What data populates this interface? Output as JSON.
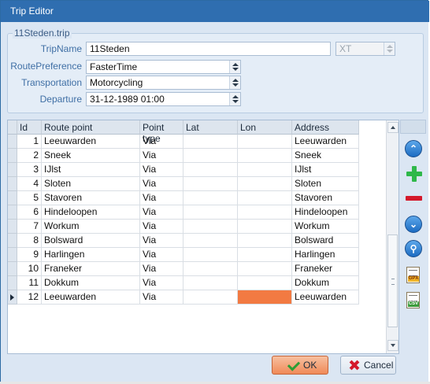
{
  "window": {
    "title": "Trip Editor"
  },
  "trip_group": {
    "legend": "11Steden.trip",
    "fields": [
      {
        "label": "TripName",
        "value": "11Steden"
      },
      {
        "label": "RoutePreference",
        "value": "FasterTime"
      },
      {
        "label": "Transportation",
        "value": "Motorcycling"
      },
      {
        "label": "Departure",
        "value": "31-12-1989 01:00"
      }
    ],
    "model_value": "XT"
  },
  "grid": {
    "columns": [
      "Id",
      "Route point",
      "Point type",
      "Lat",
      "Lon",
      "Address"
    ],
    "rows": [
      {
        "id": "1",
        "route_point": "Leeuwarden",
        "point_type": "Via",
        "lat": "",
        "lon": "",
        "address": "Leeuwarden"
      },
      {
        "id": "2",
        "route_point": "Sneek",
        "point_type": "Via",
        "lat": "",
        "lon": "",
        "address": "Sneek"
      },
      {
        "id": "3",
        "route_point": "IJlst",
        "point_type": "Via",
        "lat": "",
        "lon": "",
        "address": "IJlst"
      },
      {
        "id": "4",
        "route_point": "Sloten",
        "point_type": "Via",
        "lat": "",
        "lon": "",
        "address": "Sloten"
      },
      {
        "id": "5",
        "route_point": "Stavoren",
        "point_type": "Via",
        "lat": "",
        "lon": "",
        "address": "Stavoren"
      },
      {
        "id": "6",
        "route_point": "Hindeloopen",
        "point_type": "Via",
        "lat": "",
        "lon": "",
        "address": "Hindeloopen"
      },
      {
        "id": "7",
        "route_point": "Workum",
        "point_type": "Via",
        "lat": "",
        "lon": "",
        "address": "Workum"
      },
      {
        "id": "8",
        "route_point": "Bolsward",
        "point_type": "Via",
        "lat": "",
        "lon": "",
        "address": "Bolsward"
      },
      {
        "id": "9",
        "route_point": "Harlingen",
        "point_type": "Via",
        "lat": "",
        "lon": "",
        "address": "Harlingen"
      },
      {
        "id": "10",
        "route_point": "Franeker",
        "point_type": "Via",
        "lat": "",
        "lon": "",
        "address": "Franeker"
      },
      {
        "id": "11",
        "route_point": "Dokkum",
        "point_type": "Via",
        "lat": "",
        "lon": "",
        "address": "Dokkum"
      },
      {
        "id": "12",
        "route_point": "Leeuwarden",
        "point_type": "Via",
        "lat": "",
        "lon": "",
        "address": "Leeuwarden"
      }
    ],
    "current_row_id": "12",
    "selected_cell_color": "#f27a42"
  },
  "side_toolbar": {
    "buttons": [
      "move-top-icon",
      "add-icon",
      "remove-icon",
      "move-bottom-icon",
      "search-icon",
      "gpx-export-icon",
      "csv-export-icon"
    ],
    "gpx_label": "GPX",
    "csv_label": "CSV"
  },
  "footer": {
    "ok_label": "OK",
    "cancel_label": "Cancel"
  },
  "colors": {
    "titlebar": "#2f6eb0",
    "accent": "#f08a58"
  }
}
